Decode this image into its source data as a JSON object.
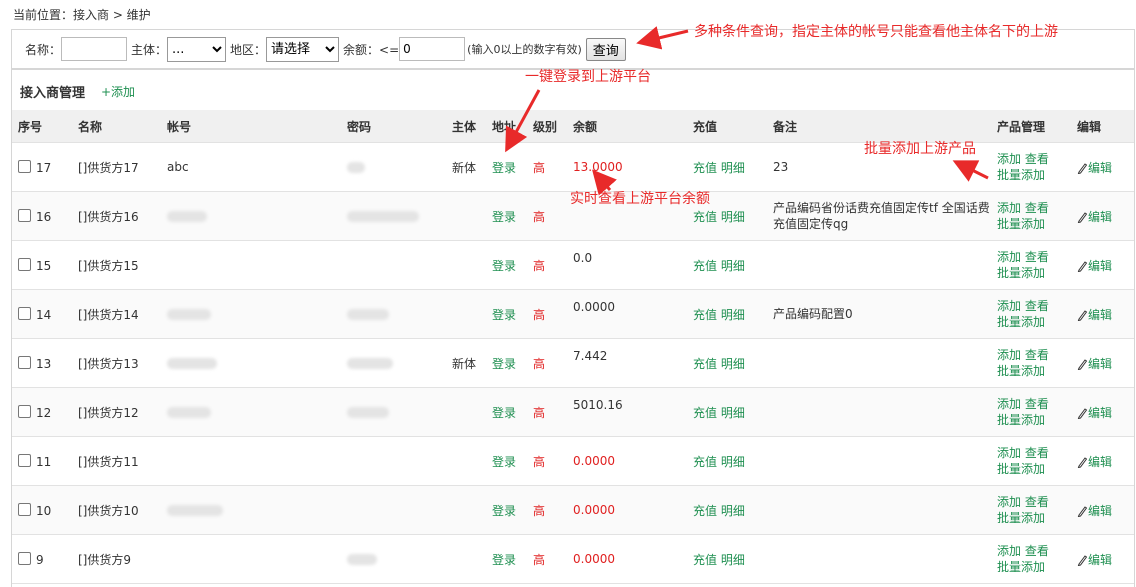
{
  "breadcrumb": "当前位置：接入商 > 维护",
  "filter": {
    "name_label": "名称：",
    "subject_label": "主体：",
    "subject_value": "...",
    "region_label": "地区：",
    "region_value": "请选择",
    "balance_label": "余额：<=",
    "balance_value": "0",
    "balance_hint": "(输入0以上的数字有效)",
    "query_button": "查询"
  },
  "panel": {
    "title": "接入商管理",
    "add_link": "+添加"
  },
  "columns": [
    "序号",
    "名称",
    "帐号",
    "密码",
    "主体",
    "地址",
    "级别",
    "余额",
    "充值",
    "备注",
    "产品管理",
    "编辑"
  ],
  "rows": [
    {
      "id": "17",
      "name": "[]供货方17",
      "account": "abc",
      "subject": "新体",
      "login": "登录",
      "level": "高",
      "balance": "13.0000",
      "balance_red": true,
      "recharge": "充值",
      "detail": "明细",
      "note": "23",
      "add": "添加",
      "view": "查看",
      "batch": "批量添加",
      "edit": "编辑"
    },
    {
      "id": "16",
      "name": "[]供货方16",
      "account": "",
      "subject": "",
      "login": "登录",
      "level": "高",
      "balance": "",
      "balance_red": false,
      "recharge": "充值",
      "detail": "明细",
      "note": "产品编码省份话费充值固定传tf 全国话费充值固定传qg",
      "add": "添加",
      "view": "查看",
      "batch": "批量添加",
      "edit": "编辑"
    },
    {
      "id": "15",
      "name": "[]供货方15",
      "account": "",
      "subject": "",
      "login": "登录",
      "level": "高",
      "balance": "0.0",
      "balance_red": false,
      "recharge": "充值",
      "detail": "明细",
      "note": "",
      "add": "添加",
      "view": "查看",
      "batch": "批量添加",
      "edit": "编辑"
    },
    {
      "id": "14",
      "name": "[]供货方14",
      "account": "",
      "subject": "",
      "login": "登录",
      "level": "高",
      "balance": "0.0000",
      "balance_red": false,
      "recharge": "充值",
      "detail": "明细",
      "note": "产品编码配置0",
      "add": "添加",
      "view": "查看",
      "batch": "批量添加",
      "edit": "编辑"
    },
    {
      "id": "13",
      "name": "[]供货方13",
      "account": "",
      "subject": "新体",
      "login": "登录",
      "level": "高",
      "balance": "7.442",
      "balance_red": false,
      "recharge": "充值",
      "detail": "明细",
      "note": "",
      "add": "添加",
      "view": "查看",
      "batch": "批量添加",
      "edit": "编辑"
    },
    {
      "id": "12",
      "name": "[]供货方12",
      "account": "",
      "subject": "",
      "login": "登录",
      "level": "高",
      "balance": "5010.16",
      "balance_red": false,
      "recharge": "充值",
      "detail": "明细",
      "note": "",
      "add": "添加",
      "view": "查看",
      "batch": "批量添加",
      "edit": "编辑"
    },
    {
      "id": "11",
      "name": "[]供货方11",
      "account": "",
      "subject": "",
      "login": "登录",
      "level": "高",
      "balance": "0.0000",
      "balance_red": true,
      "recharge": "充值",
      "detail": "明细",
      "note": "",
      "add": "添加",
      "view": "查看",
      "batch": "批量添加",
      "edit": "编辑"
    },
    {
      "id": "10",
      "name": "[]供货方10",
      "account": "",
      "subject": "",
      "login": "登录",
      "level": "高",
      "balance": "0.0000",
      "balance_red": true,
      "recharge": "充值",
      "detail": "明细",
      "note": "",
      "add": "添加",
      "view": "查看",
      "batch": "批量添加",
      "edit": "编辑"
    },
    {
      "id": "9",
      "name": "[]供货方9",
      "account": "",
      "subject": "",
      "login": "登录",
      "level": "高",
      "balance": "0.0000",
      "balance_red": true,
      "recharge": "充值",
      "detail": "明细",
      "note": "",
      "add": "添加",
      "view": "查看",
      "batch": "批量添加",
      "edit": "编辑"
    }
  ],
  "annotations": {
    "query": "多种条件查询，指定主体的帐号只能查看他主体名下的上游",
    "login": "一键登录到上游平台",
    "batch": "批量添加上游产品",
    "balance": "实时查看上游平台余额"
  },
  "colors": {
    "link_green": "#1e8f50",
    "alert_red": "#e02020",
    "annotation_red": "#e82a2a"
  }
}
